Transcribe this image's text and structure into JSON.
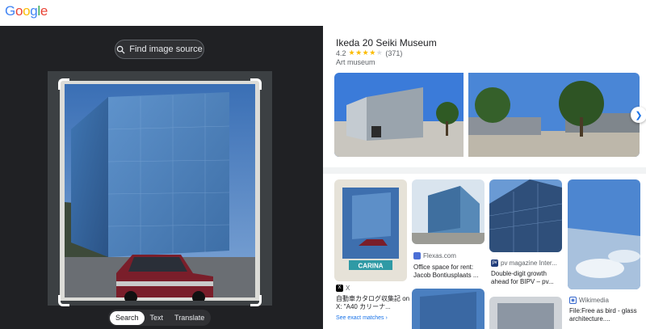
{
  "header": {
    "logo": "Google"
  },
  "left_panel": {
    "find_button": "Find image source",
    "modes": [
      "Search",
      "Text",
      "Translate"
    ],
    "active_mode": "Search"
  },
  "knowledge_panel": {
    "title": "Ikeda 20 Seiki Museum",
    "rating_value": "4.2",
    "stars": "★★★★",
    "star_empty": "★",
    "review_count": "(371)",
    "category": "Art museum"
  },
  "results": [
    {
      "source": "X",
      "title": "自動車カタログ収集記 on X: \"A40 カリーナ...",
      "extra": "See exact matches"
    },
    {
      "source": "Flexas.com",
      "title": "Office space for rent: Jacob Bontiusplaats ..."
    },
    {
      "source": "pv magazine Inter...",
      "title": "Double-digit growth ahead for BIPV – pv..."
    },
    {
      "source": "Wikimedia",
      "title": "File:Free as bird - glass architecture...."
    }
  ],
  "photo_label": "CARINA",
  "colors": {
    "accent": "#1a73e8",
    "dark_bg": "#202124",
    "star": "#fbbc04"
  }
}
